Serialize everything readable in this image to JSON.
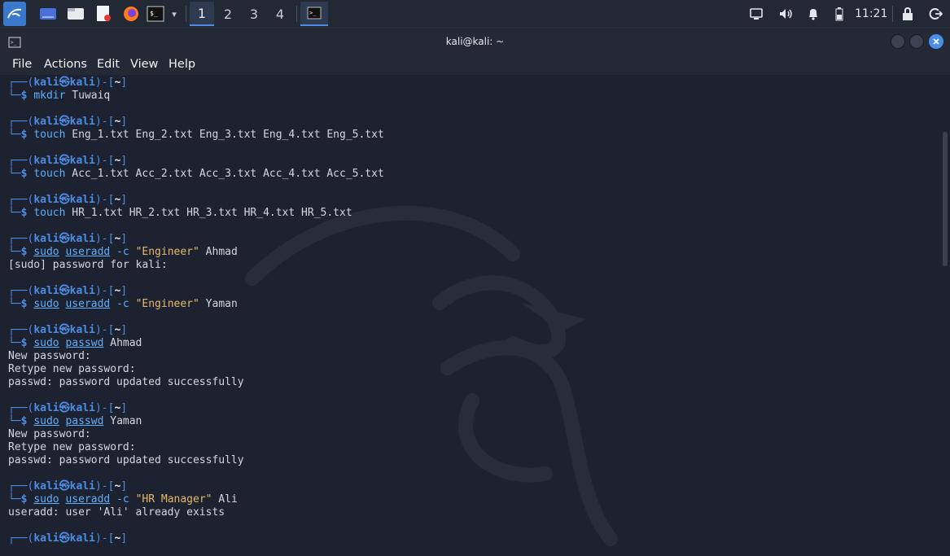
{
  "taskbar": {
    "workspaces": [
      "1",
      "2",
      "3",
      "4"
    ],
    "active_workspace": "1",
    "clock": "11:21",
    "icons": [
      "kali-menu-icon",
      "desktop-icon",
      "file-manager-icon",
      "text-editor-icon",
      "firefox-icon",
      "terminal-icon",
      "chevron-down-icon",
      "terminal-window-icon",
      "display-icon",
      "volume-icon",
      "notification-bell-icon",
      "battery-icon",
      "lock-icon",
      "logout-icon"
    ]
  },
  "window": {
    "title": "kali@kali: ~",
    "menu": [
      "File",
      "Actions",
      "Edit",
      "View",
      "Help"
    ]
  },
  "prompt": {
    "user": "kali",
    "symbol": "㉿",
    "host": "kali",
    "dir": "~",
    "dollar": "$"
  },
  "terminal": {
    "blocks": [
      {
        "cmd": "mkdir",
        "args": " Tuwaiq",
        "output": []
      },
      {
        "cmd": "touch",
        "args": " Eng_1.txt Eng_2.txt Eng_3.txt Eng_4.txt Eng_5.txt",
        "output": []
      },
      {
        "cmd": "touch",
        "args": " Acc_1.txt Acc_2.txt Acc_3.txt Acc_4.txt Acc_5.txt",
        "output": []
      },
      {
        "cmd": "touch",
        "args": " HR_1.txt HR_2.txt HR_3.txt HR_4.txt HR_5.txt",
        "output": []
      },
      {
        "sudo": "sudo",
        "cmd": "useradd -c",
        "str": "\"Engineer\"",
        "args": " Ahmad",
        "output": [
          "[sudo] password for kali:"
        ]
      },
      {
        "sudo": "sudo",
        "cmd": "useradd -c",
        "str": "\"Engineer\"",
        "args": " Yaman",
        "output": []
      },
      {
        "sudo": "sudo",
        "cmd": "passwd",
        "args": " Ahmad",
        "output": [
          "New password:",
          "Retype new password:",
          "passwd: password updated successfully"
        ]
      },
      {
        "sudo": "sudo",
        "cmd": "passwd",
        "args": " Yaman",
        "output": [
          "New password:",
          "Retype new password:",
          "passwd: password updated successfully"
        ]
      },
      {
        "sudo": "sudo",
        "cmd": "useradd -c",
        "str": "\"HR Manager\"",
        "args": " Ali",
        "output": [
          "useradd: user 'Ali' already exists"
        ]
      }
    ]
  },
  "colors": {
    "prompt_blue": "#4c8de8",
    "command": "#5fb0ff",
    "string": "#e7b86a",
    "background": "#1d2230"
  }
}
